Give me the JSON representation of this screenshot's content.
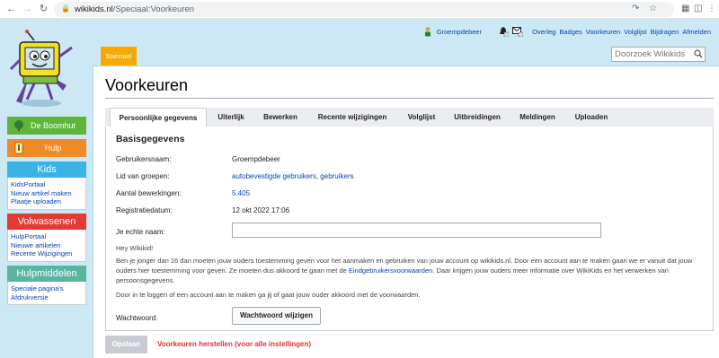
{
  "browser": {
    "url_domain": "wikikids.nl",
    "url_path": "/Speciaal:Voorkeuren"
  },
  "sidebar": {
    "boomhut_label": "De Boomhut",
    "hulp_label": "Hulp",
    "kids": {
      "title": "Kids",
      "links": [
        "KidsPortaal",
        "Nieuw artikel maken",
        "Plaatje uploaden"
      ]
    },
    "volwassenen": {
      "title": "Volwassenen",
      "links": [
        "HulpPortaal",
        "Nieuwe artikelen",
        "Recente Wijzigingen"
      ]
    },
    "hulpmiddelen": {
      "title": "Hulpmiddelen",
      "links": [
        "Speciale pagina's",
        "Afdrukversie"
      ]
    }
  },
  "userlinks": {
    "username": "Groempdebeer",
    "overleg": "Overleg",
    "badges": "Badges",
    "voorkeuren": "Voorkeuren",
    "volglijst": "Volglijst",
    "bijdragen": "Bijdragen",
    "afmelden": "Afmelden"
  },
  "tab_speciaal": "Speciaal",
  "search": {
    "placeholder": "Doorzoek Wikikids"
  },
  "page": {
    "title": "Voorkeuren",
    "tabs": [
      "Persoonlijke gegevens",
      "Uiterlijk",
      "Bewerken",
      "Recente wijzigingen",
      "Volglijst",
      "Uitbreidingen",
      "Meldingen",
      "Uploaden"
    ],
    "section_title": "Basisgegevens",
    "rows": {
      "username_label": "Gebruikersnaam:",
      "username_value": "Groempdebeer",
      "groups_label": "Lid van groepen:",
      "groups_link1": "autobevestigde gebruikers",
      "groups_sep": ", ",
      "groups_link2": "gebruikers",
      "edits_label": "Aantal bewerkingen:",
      "edits_value": "5.405",
      "regdate_label": "Registratiedatum:",
      "regdate_value": "12 okt 2022 17:06",
      "realname_label": "Je echte naam:",
      "password_label": "Wachtwoord:"
    },
    "hey": "Hey Wikikid!",
    "consent_1": "Ben je jonger dan 16 dan moeten jouw ouders toestemming geven voor het aanmaken en gebruiken van jouw account op wikikids.nl. Door een account aan te maken gaan we er vanuit dat jouw ouders hier toestemming voor geven. Ze moeten dus akkoord te gaan met de ",
    "consent_link": "Eindgebruikersvoorwaarden",
    "consent_2": ". Daar krijgen jouw ouders meer informatie over WikiKids en het verwerken van persoonsgegevens.",
    "login_note": "Door in te loggen of een account aan te maken ga jij of gaat jouw ouder akkoord met de voorwaarden.",
    "change_password": "Wachtwoord wijzigen",
    "save": "Opslaan",
    "reset": "Voorkeuren herstellen (voor alle instellingen)"
  },
  "colors": {
    "page_bg": "#cce8f4",
    "boomhut": "#5fb53a",
    "hulp": "#f08a24",
    "kids": "#3ab4e6",
    "volwassenen": "#e53935",
    "hulpmiddelen": "#5ab5a0",
    "speciaal": "#f6a900",
    "link": "#0645ad",
    "reset": "#d33333"
  }
}
